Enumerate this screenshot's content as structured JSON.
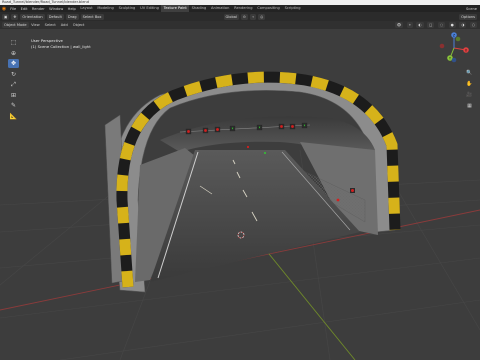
{
  "window": {
    "title": "Road_Tunnel/blender/Road_Tunnel/blender.blend"
  },
  "menubar": {
    "items": [
      "File",
      "Edit",
      "Render",
      "Window",
      "Help"
    ],
    "workspaces": [
      "Layout",
      "Modeling",
      "Sculpting",
      "UV Editing",
      "Texture Paint",
      "Shading",
      "Animation",
      "Rendering",
      "Compositing",
      "Scripting"
    ],
    "active_workspace": "Texture Paint",
    "scene_label": "Scene"
  },
  "tool_header": {
    "orientation_label": "Orientation",
    "orientation_value": "Default",
    "drag_label": "Drag",
    "drag_value": "Select Box",
    "transform_value": "Global",
    "options_label": "Options"
  },
  "viewport_header": {
    "mode": "Object Mode",
    "menus": [
      "View",
      "Select",
      "Add",
      "Object"
    ]
  },
  "viewport": {
    "perspective": "User Perspective",
    "collection": "(1) Scene Collection | wall_light",
    "grid_color": "#474747",
    "x_axis_color": "#8a3b3b",
    "y_axis_color": "#6f8a2a"
  },
  "toolbar": {
    "tools": [
      "select-box",
      "cursor",
      "move",
      "rotate",
      "scale",
      "transform",
      "annotate",
      "measure"
    ],
    "active_tool": "move"
  },
  "gizmo": {
    "x": "X",
    "y": "Y",
    "z": "Z"
  }
}
